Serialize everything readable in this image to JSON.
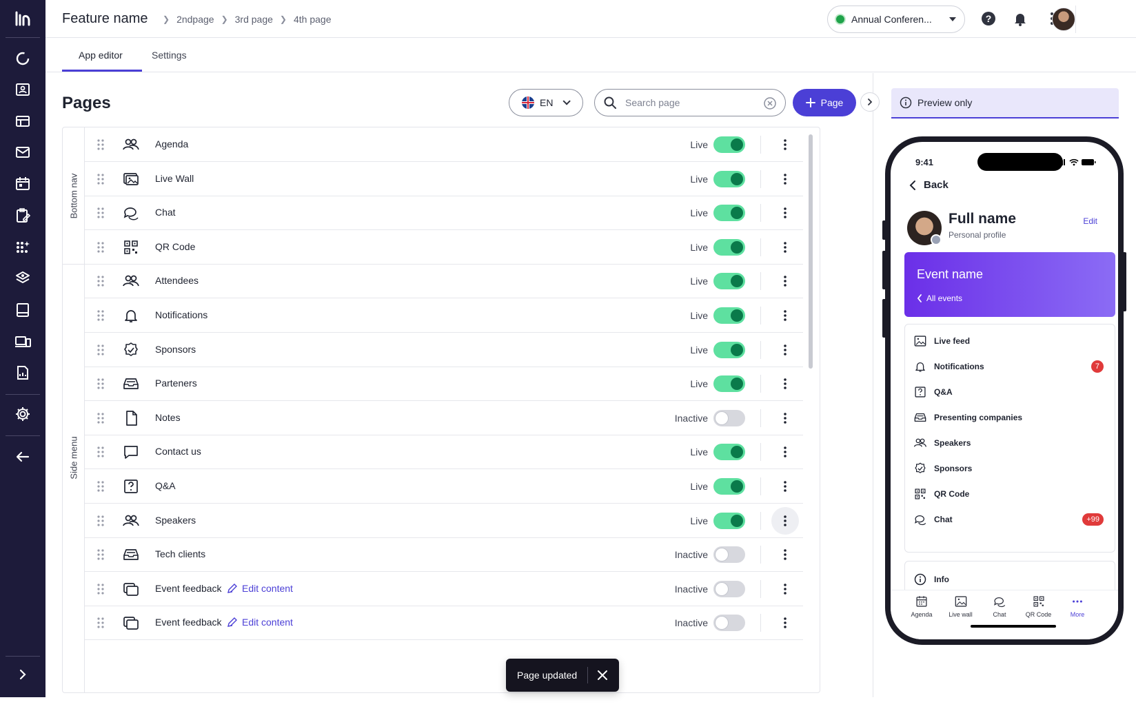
{
  "header": {
    "title": "Feature name",
    "breadcrumbs": [
      "2ndpage",
      "3rd page",
      "4th page"
    ],
    "event_selector": "Annual Conferen..."
  },
  "tabs": [
    {
      "label": "App editor",
      "active": true
    },
    {
      "label": "Settings",
      "active": false
    }
  ],
  "pages_section": {
    "title": "Pages",
    "language": "EN",
    "search_placeholder": "Search page",
    "add_button": "Page",
    "groups": [
      {
        "label": "Bottom nav"
      },
      {
        "label": "Side menu"
      }
    ],
    "rows": [
      {
        "label": "Agenda",
        "icon": "people-icon",
        "status": "Live",
        "enabled": true,
        "edit_link": ""
      },
      {
        "label": "Live Wall",
        "icon": "image-stack-icon",
        "status": "Live",
        "enabled": true,
        "edit_link": ""
      },
      {
        "label": "Chat",
        "icon": "chat-bubbles-icon",
        "status": "Live",
        "enabled": true,
        "edit_link": ""
      },
      {
        "label": "QR Code",
        "icon": "qr-code-icon",
        "status": "Live",
        "enabled": true,
        "edit_link": ""
      },
      {
        "label": "Attendees",
        "icon": "people-icon",
        "status": "Live",
        "enabled": true,
        "edit_link": ""
      },
      {
        "label": "Notifications",
        "icon": "bell-icon",
        "status": "Live",
        "enabled": true,
        "edit_link": ""
      },
      {
        "label": "Sponsors",
        "icon": "badge-check-icon",
        "status": "Live",
        "enabled": true,
        "edit_link": ""
      },
      {
        "label": "Parteners",
        "icon": "inbox-icon",
        "status": "Live",
        "enabled": true,
        "edit_link": ""
      },
      {
        "label": "Notes",
        "icon": "document-icon",
        "status": "Inactive",
        "enabled": false,
        "edit_link": ""
      },
      {
        "label": "Contact us",
        "icon": "speech-bubble-icon",
        "status": "Live",
        "enabled": true,
        "edit_link": ""
      },
      {
        "label": "Q&A",
        "icon": "question-box-icon",
        "status": "Live",
        "enabled": true,
        "edit_link": ""
      },
      {
        "label": "Speakers",
        "icon": "people-icon",
        "status": "Live",
        "enabled": true,
        "edit_link": ""
      },
      {
        "label": "Tech clients",
        "icon": "inbox-icon",
        "status": "Inactive",
        "enabled": false,
        "edit_link": ""
      },
      {
        "label": "Event feedback",
        "icon": "cards-icon",
        "status": "Inactive",
        "enabled": false,
        "edit_link": "Edit content"
      },
      {
        "label": "Event feedback",
        "icon": "cards-icon",
        "status": "Inactive",
        "enabled": false,
        "edit_link": "Edit content"
      }
    ]
  },
  "toast": {
    "text": "Page updated"
  },
  "preview": {
    "banner": "Preview only",
    "time": "9:41",
    "back": "Back",
    "profile_name": "Full name",
    "profile_sub": "Personal profile",
    "edit": "Edit",
    "event_name": "Event name",
    "all_events": "All events",
    "menu": [
      {
        "label": "Live feed",
        "icon": "image-icon",
        "badge": ""
      },
      {
        "label": "Notifications",
        "icon": "bell-icon",
        "badge": "7"
      },
      {
        "label": "Q&A",
        "icon": "question-box-icon",
        "badge": ""
      },
      {
        "label": "Presenting companies",
        "icon": "inbox-icon",
        "badge": ""
      },
      {
        "label": "Speakers",
        "icon": "people-icon",
        "badge": ""
      },
      {
        "label": "Sponsors",
        "icon": "badge-check-icon",
        "badge": ""
      },
      {
        "label": "QR Code",
        "icon": "qr-code-icon",
        "badge": ""
      },
      {
        "label": "Chat",
        "icon": "chat-bubbles-icon",
        "badge": "+99"
      }
    ],
    "info": "Info",
    "tabbar": [
      {
        "label": "Agenda",
        "icon": "calendar-icon"
      },
      {
        "label": "Live wall",
        "icon": "image-icon"
      },
      {
        "label": "Chat",
        "icon": "chat-bubbles-icon"
      },
      {
        "label": "QR Code",
        "icon": "qr-code-icon"
      },
      {
        "label": "More",
        "icon": "more-horizontal-icon"
      }
    ]
  },
  "colors": {
    "brand": "#4b3fd6",
    "rail": "#1d1b3a",
    "live": "#5ee0a0",
    "badge": "#e03a3a"
  }
}
